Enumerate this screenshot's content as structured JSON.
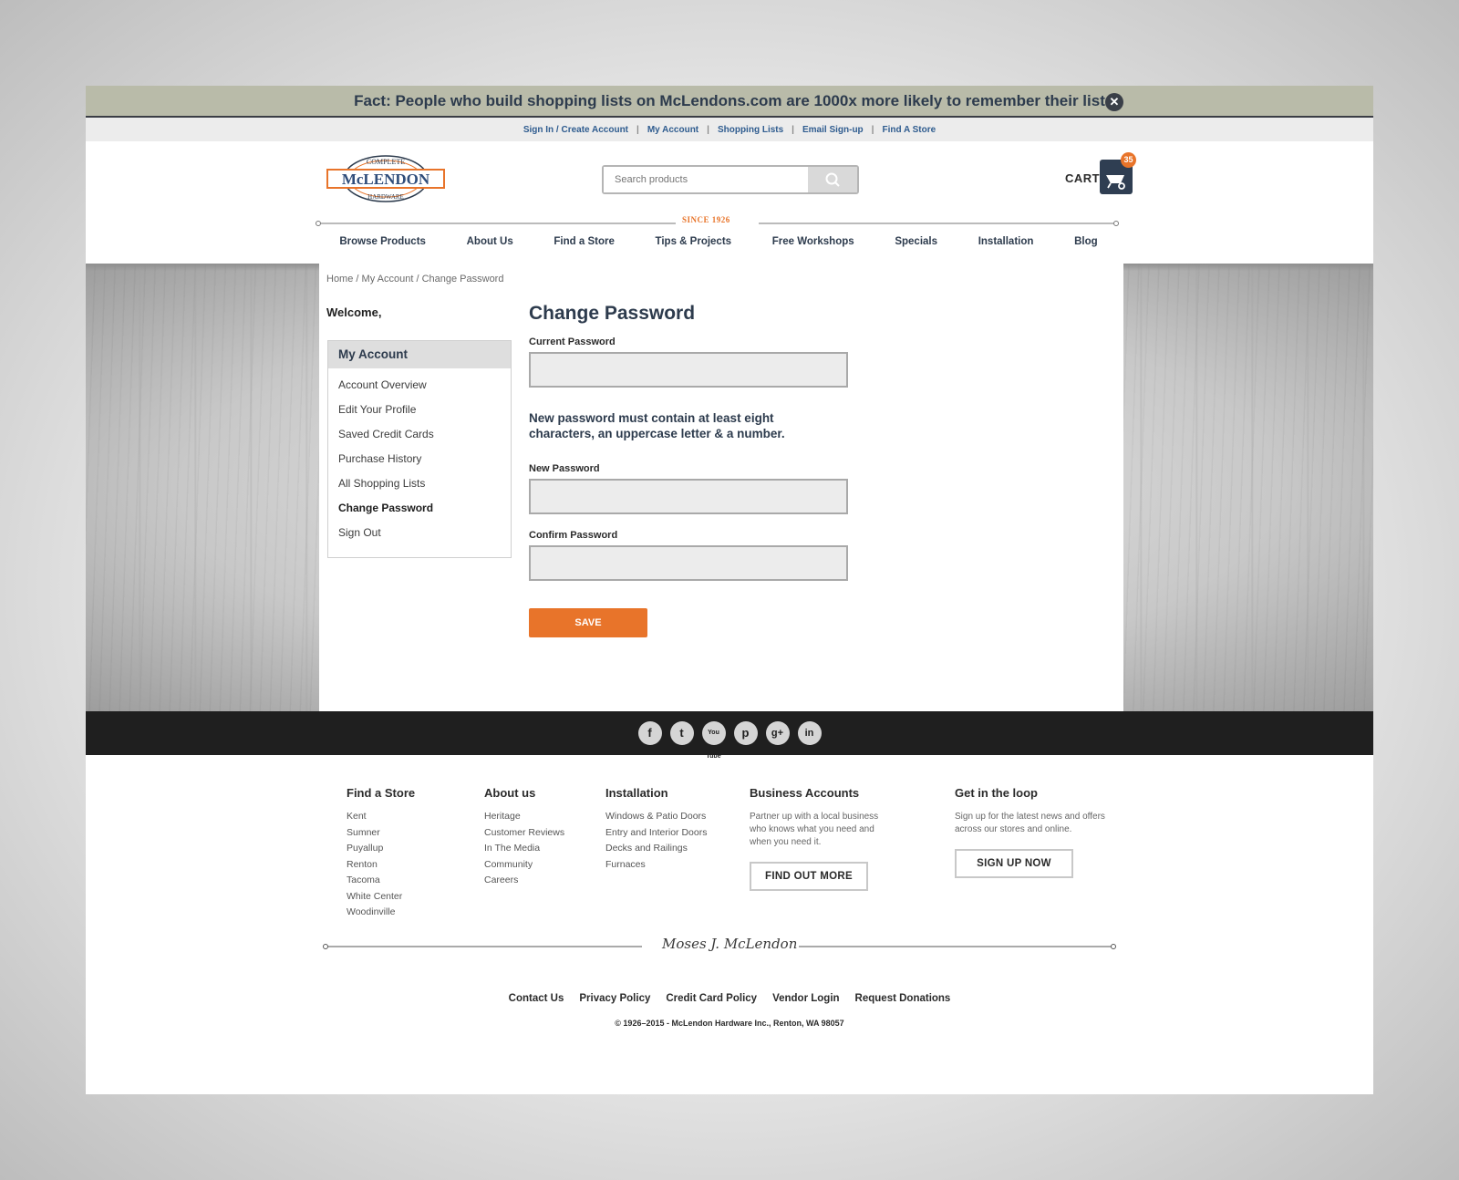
{
  "announcement": {
    "text": "Fact: People who build shopping lists on McLendons.com are 1000x more likely to remember their list",
    "close_icon": "close-icon"
  },
  "utility_links": [
    "Sign In / Create Account",
    "My Account",
    "Shopping Lists",
    "Email Sign-up",
    "Find A Store"
  ],
  "header": {
    "logo_text": {
      "top": "COMPLETE",
      "main": "McLENDON",
      "bottom": "HARDWARE"
    },
    "search_placeholder": "Search products",
    "cart_label": "CART",
    "cart_count": "35",
    "since": "SINCE 1926"
  },
  "main_nav": [
    "Browse Products",
    "About Us",
    "Find a Store",
    "Tips & Projects",
    "Free Workshops",
    "Specials",
    "Installation",
    "Blog"
  ],
  "breadcrumb": {
    "home": "Home",
    "account": "My Account",
    "current": "Change Password",
    "sep": "/"
  },
  "sidebar": {
    "welcome": "Welcome,",
    "title": "My Account",
    "items": [
      {
        "label": "Account Overview"
      },
      {
        "label": "Edit Your Profile"
      },
      {
        "label": "Saved Credit Cards"
      },
      {
        "label": "Purchase History"
      },
      {
        "label": "All Shopping Lists"
      },
      {
        "label": "Change Password",
        "active": true
      },
      {
        "label": "Sign Out"
      }
    ]
  },
  "form": {
    "title": "Change Password",
    "current_label": "Current Password",
    "rules": "New password must contain at least eight characters, an uppercase letter & a number.",
    "new_label": "New Password",
    "confirm_label": "Confirm Password",
    "save_label": "SAVE"
  },
  "social": [
    "f",
    "t",
    "You Tube",
    "p",
    "g+",
    "in"
  ],
  "footer": {
    "stores": {
      "title": "Find a Store",
      "items": [
        "Kent",
        "Sumner",
        "Puyallup",
        "Renton",
        "Tacoma",
        "White Center",
        "Woodinville"
      ]
    },
    "about": {
      "title": "About us",
      "items": [
        "Heritage",
        "Customer Reviews",
        "In The Media",
        "Community",
        "Careers"
      ]
    },
    "installation": {
      "title": "Installation",
      "items": [
        "Windows & Patio Doors",
        "Entry and Interior Doors",
        "Decks and Railings",
        "Furnaces"
      ]
    },
    "business": {
      "title": "Business Accounts",
      "text": "Partner up with a local business who knows what you need and when you need it.",
      "button": "FIND OUT MORE"
    },
    "loop": {
      "title": "Get in the loop",
      "text": "Sign up for the latest news and offers across our stores and online.",
      "button": "SIGN UP NOW"
    },
    "signature": "Moses J. McLendon",
    "links": [
      "Contact Us",
      "Privacy Policy",
      "Credit Card Policy",
      "Vendor Login",
      "Request Donations"
    ],
    "copyright": "© 1926–2015 - McLendon Hardware Inc., Renton, WA 98057"
  },
  "colors": {
    "accent": "#e8742a",
    "navy": "#2d3b4d",
    "link": "#2f5c8f"
  }
}
